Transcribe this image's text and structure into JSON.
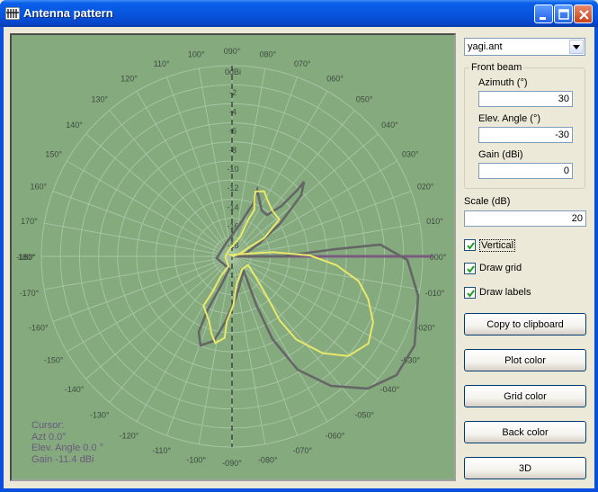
{
  "window": {
    "title": "Antenna pattern"
  },
  "plot": {
    "angle_labels": [
      {
        "deg": 0,
        "text": "000°"
      },
      {
        "deg": 10,
        "text": "010°"
      },
      {
        "deg": 20,
        "text": "020°"
      },
      {
        "deg": 30,
        "text": "030°"
      },
      {
        "deg": 40,
        "text": "040°"
      },
      {
        "deg": 50,
        "text": "050°"
      },
      {
        "deg": 60,
        "text": "060°"
      },
      {
        "deg": 70,
        "text": "070°"
      },
      {
        "deg": 80,
        "text": "080°"
      },
      {
        "deg": 90,
        "text": "090°"
      },
      {
        "deg": 100,
        "text": "100°"
      },
      {
        "deg": 110,
        "text": "110°"
      },
      {
        "deg": 120,
        "text": "120°"
      },
      {
        "deg": 130,
        "text": "130°"
      },
      {
        "deg": 140,
        "text": "140°"
      },
      {
        "deg": 150,
        "text": "150°"
      },
      {
        "deg": 160,
        "text": "160°"
      },
      {
        "deg": 170,
        "text": "170°"
      },
      {
        "deg": 180,
        "text": "180°"
      },
      {
        "deg": -10,
        "text": "-010°"
      },
      {
        "deg": -20,
        "text": "-020°"
      },
      {
        "deg": -30,
        "text": "-030°"
      },
      {
        "deg": -40,
        "text": "-040°"
      },
      {
        "deg": -50,
        "text": "-050°"
      },
      {
        "deg": -60,
        "text": "-060°"
      },
      {
        "deg": -70,
        "text": "-070°"
      },
      {
        "deg": -80,
        "text": "-080°"
      },
      {
        "deg": -90,
        "text": "-090°"
      },
      {
        "deg": -100,
        "text": "-100°"
      },
      {
        "deg": -110,
        "text": "-110°"
      },
      {
        "deg": -120,
        "text": "-120°"
      },
      {
        "deg": -130,
        "text": "-130°"
      },
      {
        "deg": -140,
        "text": "-140°"
      },
      {
        "deg": -150,
        "text": "-150°"
      },
      {
        "deg": -160,
        "text": "-160°"
      },
      {
        "deg": -170,
        "text": "-170°"
      },
      {
        "deg": -180,
        "text": "-180°"
      }
    ],
    "ring_labels": [
      "0dBi",
      "-2",
      "-4",
      "-6",
      "-8",
      "-10",
      "-12",
      "-14",
      "-16",
      "-18"
    ],
    "colors": {
      "background": "#84aa7e",
      "grid": "#a7c4a3",
      "axis": "#1a1a1a",
      "label": "#3f4a3f",
      "vertical_plot": "#e8e86a",
      "horizontal_plot": "#666666",
      "reference_line": "#7a5a80",
      "cursor_text": "#6b5a7e"
    },
    "cursor": {
      "title": "Cursor:",
      "azimuth": "Azt 0.0°",
      "elevation": "Elev. Angle 0.0 °",
      "gain": "Gain -11.4 dBi"
    }
  },
  "controls": {
    "file_select": {
      "value": "yagi.ant"
    },
    "front_beam": {
      "title": "Front beam",
      "azimuth": {
        "label": "Azimuth (°)",
        "value": "30"
      },
      "elevation": {
        "label": "Elev. Angle (°)",
        "value": "-30"
      },
      "gain": {
        "label": "Gain (dBi)",
        "value": "0"
      }
    },
    "scale": {
      "label": "Scale (dB)",
      "value": "20"
    },
    "checkboxes": {
      "vertical": {
        "label": "Vertical",
        "checked": true
      },
      "draw_grid": {
        "label": "Draw grid",
        "checked": true
      },
      "draw_labels": {
        "label": "Draw labels",
        "checked": true
      }
    },
    "buttons": {
      "copy": "Copy to clipboard",
      "plot_color": "Plot color",
      "grid_color": "Grid color",
      "back_color": "Back color",
      "three_d": "3D"
    }
  }
}
